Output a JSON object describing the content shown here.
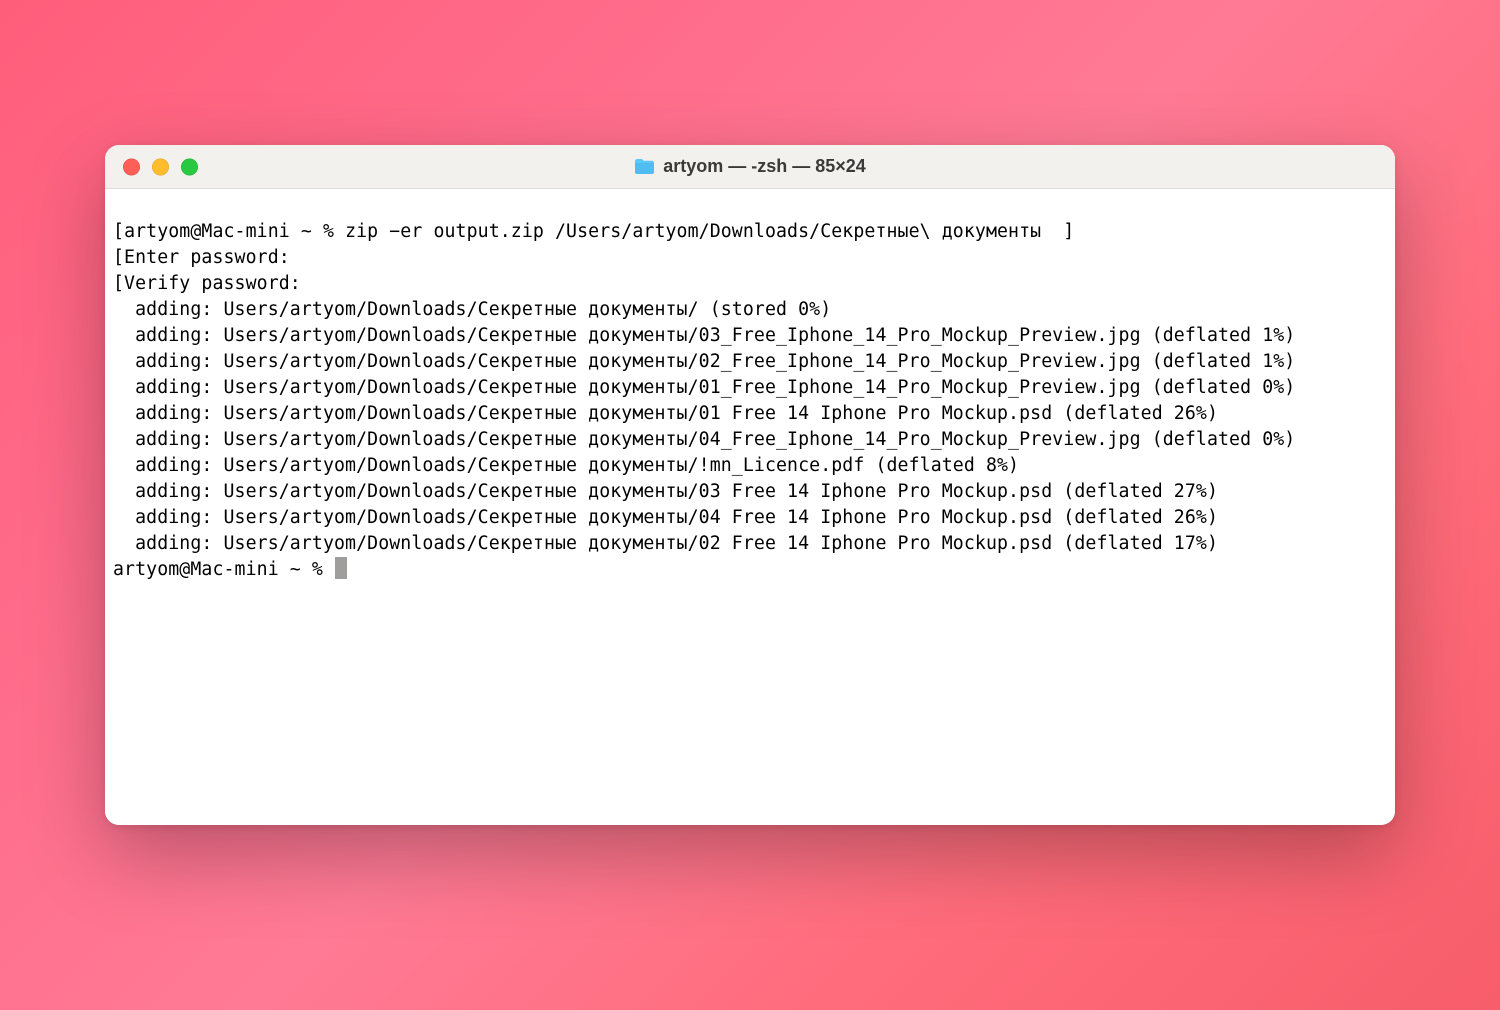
{
  "window": {
    "title": "artyom — -zsh — 85×24",
    "folder_icon": "folder-icon"
  },
  "terminal": {
    "prompt1_prefix": "[",
    "prompt1": "artyom@Mac-mini ~ % ",
    "command1": "zip −er output.zip /Users/artyom/Downloads/Секретные\\ документы",
    "prompt1_suffix": "  ]",
    "enter_line": "[Enter password:",
    "verify_line": "[Verify password:",
    "output_lines": [
      "  adding: Users/artyom/Downloads/Секретные документы/ (stored 0%)",
      "  adding: Users/artyom/Downloads/Секретные документы/03_Free_Iphone_14_Pro_Mockup_Preview.jpg (deflated 1%)",
      "  adding: Users/artyom/Downloads/Секретные документы/02_Free_Iphone_14_Pro_Mockup_Preview.jpg (deflated 1%)",
      "  adding: Users/artyom/Downloads/Секретные документы/01_Free_Iphone_14_Pro_Mockup_Preview.jpg (deflated 0%)",
      "  adding: Users/artyom/Downloads/Секретные документы/01 Free 14 Iphone Pro Mockup.psd (deflated 26%)",
      "  adding: Users/artyom/Downloads/Секретные документы/04_Free_Iphone_14_Pro_Mockup_Preview.jpg (deflated 0%)",
      "  adding: Users/artyom/Downloads/Секретные документы/!mn_Licence.pdf (deflated 8%)",
      "  adding: Users/artyom/Downloads/Секретные документы/03 Free 14 Iphone Pro Mockup.psd (deflated 27%)",
      "  adding: Users/artyom/Downloads/Секретные документы/04 Free 14 Iphone Pro Mockup.psd (deflated 26%)",
      "  adding: Users/artyom/Downloads/Секретные документы/02 Free 14 Iphone Pro Mockup.psd (deflated 17%)"
    ],
    "prompt2": "artyom@Mac-mini ~ % "
  }
}
